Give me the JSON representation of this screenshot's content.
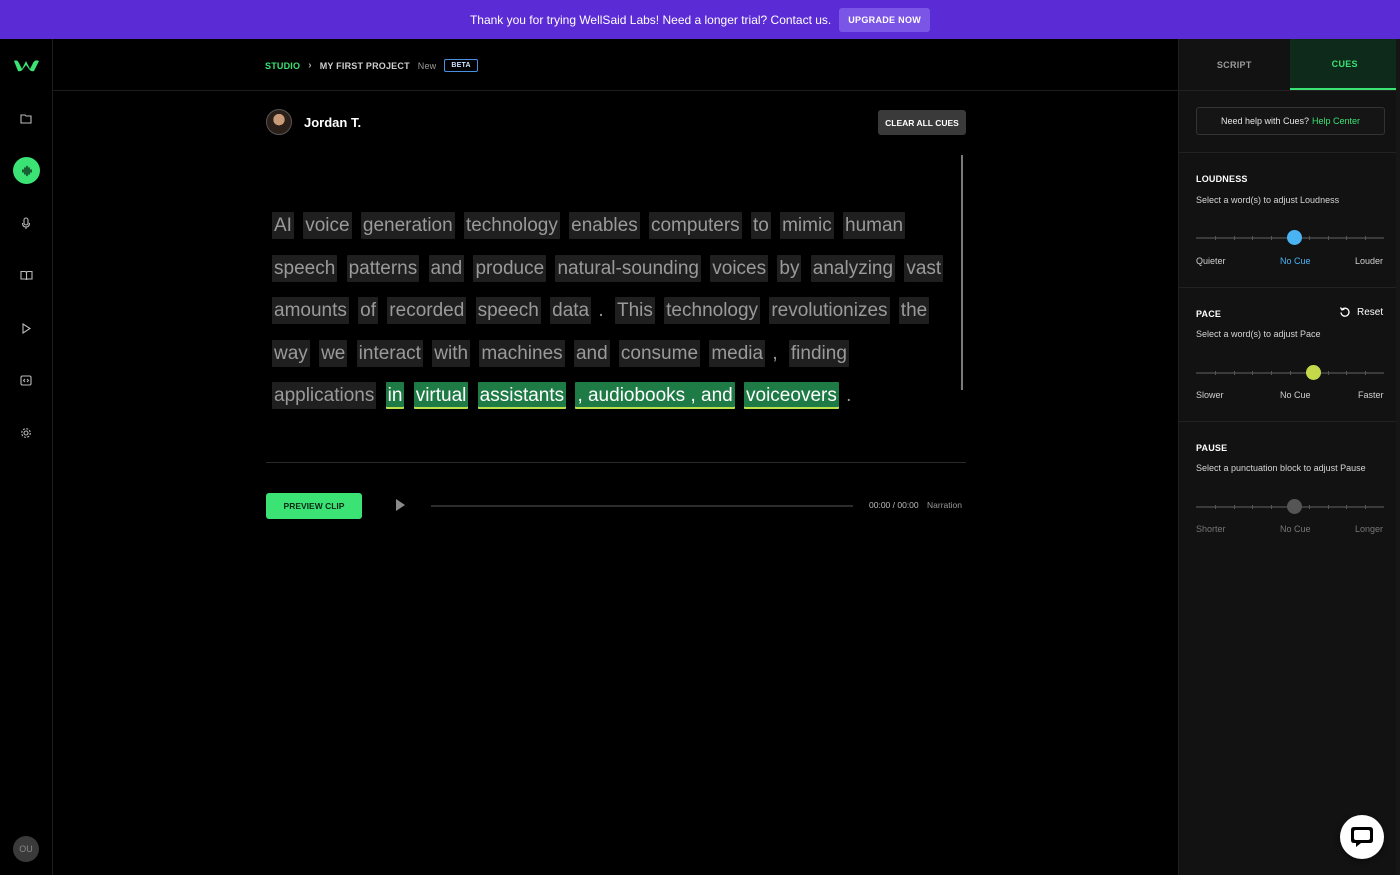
{
  "banner": {
    "text": "Thank you for trying WellSaid Labs! Need a longer trial? Contact us.",
    "button": "UPGRADE NOW"
  },
  "sidebar": {
    "avatar_initials": "OU",
    "icons": [
      "folder-icon",
      "waveform-icon",
      "microphone-icon",
      "book-icon",
      "play-icon",
      "embed-icon",
      "gear-icon"
    ]
  },
  "breadcrumb": {
    "studio": "STUDIO",
    "project": "MY FIRST PROJECT",
    "status": "New",
    "badge": "BETA"
  },
  "editor": {
    "voice_name": "Jordan T.",
    "clear_button": "CLEAR ALL CUES",
    "words": [
      {
        "t": "AI"
      },
      {
        "t": "voice"
      },
      {
        "t": "generation"
      },
      {
        "t": "technology"
      },
      {
        "t": "enables"
      },
      {
        "t": "computers"
      },
      {
        "t": "to"
      },
      {
        "t": "mimic"
      },
      {
        "t": "human"
      },
      {
        "t": "speech"
      },
      {
        "t": "patterns"
      },
      {
        "t": "and"
      },
      {
        "t": "produce"
      },
      {
        "t": "natural-sounding"
      },
      {
        "t": "voices"
      },
      {
        "t": "by"
      },
      {
        "t": "analyzing"
      },
      {
        "t": "vast"
      },
      {
        "t": "amounts"
      },
      {
        "t": "of"
      },
      {
        "t": "recorded"
      },
      {
        "t": "speech"
      },
      {
        "t": "data"
      },
      {
        "t": ".",
        "p": true
      },
      {
        "t": "This"
      },
      {
        "t": "technology"
      },
      {
        "t": "revolutionizes"
      },
      {
        "t": "the"
      },
      {
        "t": "way"
      },
      {
        "t": "we"
      },
      {
        "t": "interact"
      },
      {
        "t": "with"
      },
      {
        "t": "machines"
      },
      {
        "t": "and"
      },
      {
        "t": "consume"
      },
      {
        "t": "media"
      },
      {
        "t": ",",
        "p": true
      },
      {
        "t": "finding"
      },
      {
        "t": "applications"
      },
      {
        "t": "in",
        "hl": true
      },
      {
        "t": "virtual",
        "hl": true
      },
      {
        "t": "assistants",
        "hl": true
      },
      {
        "t": ", audiobooks , and",
        "hl": true
      },
      {
        "t": "voiceovers",
        "hl": true
      },
      {
        "t": ".",
        "p": true
      }
    ],
    "preview_button": "PREVIEW CLIP",
    "time": "00:00 / 00:00",
    "track": "Narration"
  },
  "panel": {
    "tabs": [
      "SCRIPT",
      "CUES"
    ],
    "active_tab": "CUES",
    "help_text": "Need help with Cues?",
    "help_link": "Help Center",
    "loudness": {
      "title": "LOUDNESS",
      "subtitle": "Select a word(s) to adjust Loudness",
      "min_label": "Quieter",
      "mid_label": "No Cue",
      "max_label": "Louder",
      "value": 0.52,
      "color": "#4ab3f4"
    },
    "pace": {
      "title": "PACE",
      "subtitle": "Select a word(s) to adjust Pace",
      "reset": "Reset",
      "min_label": "Slower",
      "mid_label": "No Cue",
      "max_label": "Faster",
      "value": 0.62,
      "color": "#c4d94a"
    },
    "pause": {
      "title": "PAUSE",
      "subtitle": "Select a punctuation block to adjust Pause",
      "min_label": "Shorter",
      "mid_label": "No Cue",
      "max_label": "Longer",
      "value": 0.52,
      "color": "#555555"
    }
  },
  "colors": {
    "accent": "#3ae374",
    "banner": "#5b2bd6",
    "highlight": "#1e7b45"
  }
}
